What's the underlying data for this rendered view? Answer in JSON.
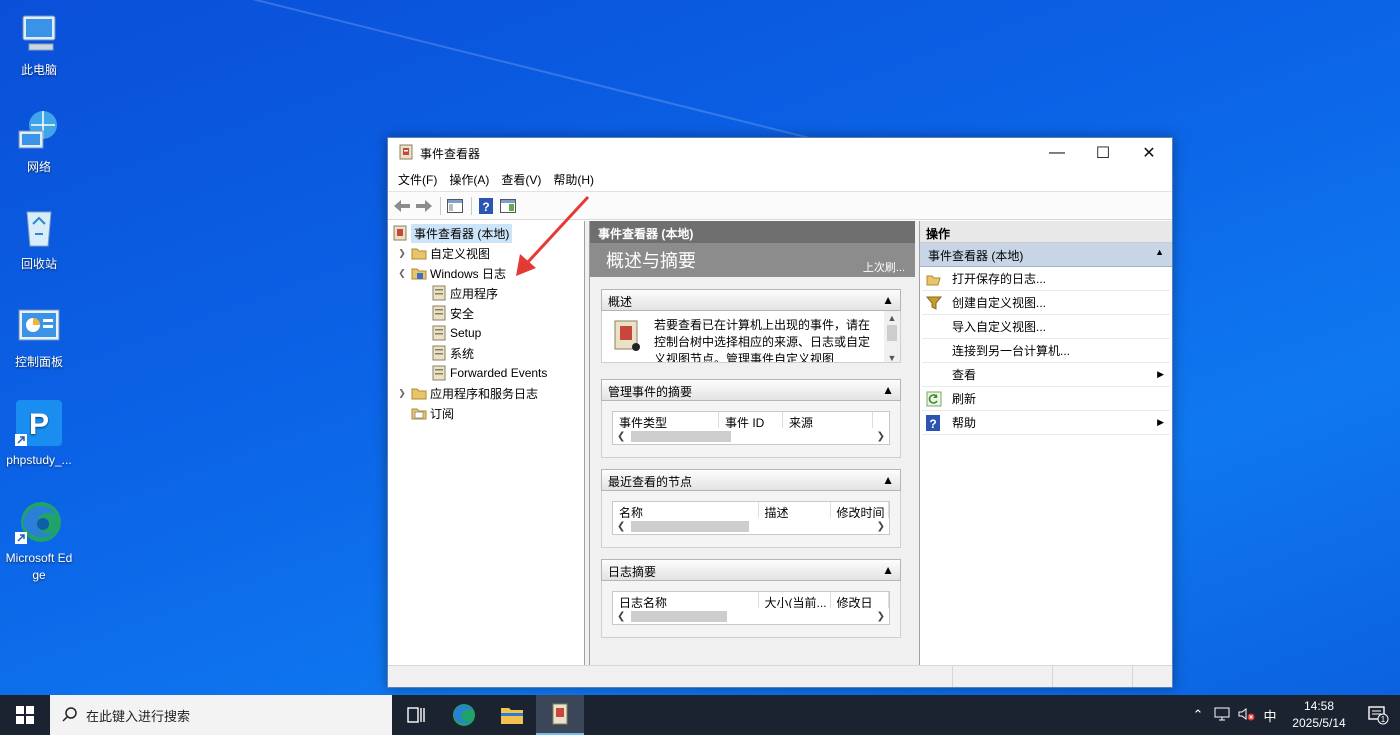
{
  "desktop": {
    "icons": [
      {
        "label": "此电脑",
        "icon": "computer-icon"
      },
      {
        "label": "网络",
        "icon": "network-icon"
      },
      {
        "label": "回收站",
        "icon": "recycle-bin-icon"
      },
      {
        "label": "控制面板",
        "icon": "control-panel-icon"
      },
      {
        "label": "phpstudy_...",
        "icon": "phpstudy-icon"
      },
      {
        "label": "Microsoft Edge",
        "icon": "edge-icon"
      }
    ]
  },
  "window": {
    "title": "事件查看器",
    "menu": [
      "文件(F)",
      "操作(A)",
      "查看(V)",
      "帮助(H)"
    ],
    "tree": {
      "root": "事件查看器 (本地)",
      "custom_views": "自定义视图",
      "windows_logs": "Windows 日志",
      "logs": [
        "应用程序",
        "安全",
        "Setup",
        "系统",
        "Forwarded Events"
      ],
      "app_service_logs": "应用程序和服务日志",
      "subscriptions": "订阅"
    },
    "center": {
      "header": "事件查看器 (本地)",
      "banner_title": "概述与摘要",
      "banner_refresh": "上次刷...",
      "overview": {
        "title": "概述",
        "text": "若要查看已在计算机上出现的事件，请在控制台树中选择相应的来源、日志或自定义视图节点。管理事件自定义视图"
      },
      "admin_summary": {
        "title": "管理事件的摘要",
        "columns": [
          "事件类型",
          "事件 ID",
          "来源"
        ]
      },
      "recent_nodes": {
        "title": "最近查看的节点",
        "columns": [
          "名称",
          "描述",
          "修改时间"
        ]
      },
      "log_summary": {
        "title": "日志摘要",
        "columns": [
          "日志名称",
          "大小(当前...",
          "修改日"
        ]
      }
    },
    "actions": {
      "header": "操作",
      "group": "事件查看器 (本地)",
      "items": [
        {
          "label": "打开保存的日志...",
          "icon": "folder-open-icon",
          "submenu": false
        },
        {
          "label": "创建自定义视图...",
          "icon": "filter-icon",
          "submenu": false
        },
        {
          "label": "导入自定义视图...",
          "icon": "",
          "submenu": false
        },
        {
          "label": "连接到另一台计算机...",
          "icon": "",
          "submenu": false
        },
        {
          "label": "查看",
          "icon": "",
          "submenu": true
        },
        {
          "label": "刷新",
          "icon": "refresh-icon",
          "submenu": false
        },
        {
          "label": "帮助",
          "icon": "help-icon",
          "submenu": true
        }
      ]
    }
  },
  "taskbar": {
    "search_placeholder": "在此键入进行搜索",
    "ime": "中",
    "time": "14:58",
    "date": "2025/5/14",
    "notification_count": "1"
  }
}
